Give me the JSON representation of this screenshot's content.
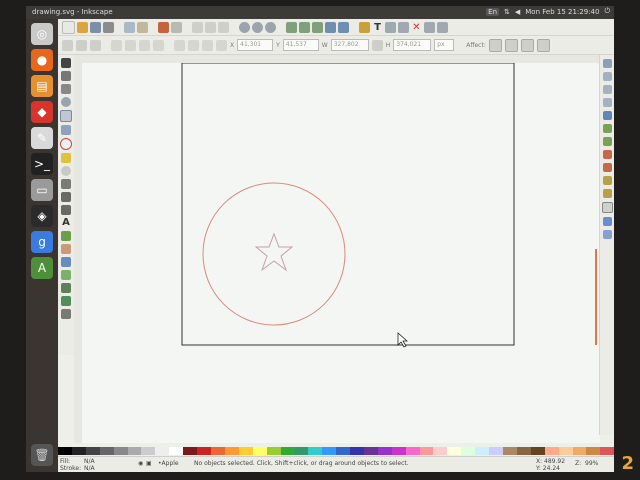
{
  "window": {
    "title": "drawing.svg - Inkscape"
  },
  "panel": {
    "clock": "Mon Feb 15 21:29:40",
    "power_glyph": "⏻",
    "indicator_glyph": "En"
  },
  "launcher": {
    "items": [
      {
        "name": "ubuntu-dash-icon",
        "glyph": "◎",
        "color": "#c9c9c9"
      },
      {
        "name": "firefox-icon",
        "glyph": "●",
        "color": "#e8671c"
      },
      {
        "name": "files-icon",
        "glyph": "▤",
        "color": "#e7902f"
      },
      {
        "name": "app-red-icon",
        "glyph": "◆",
        "color": "#d8332c"
      },
      {
        "name": "text-editor-icon",
        "glyph": "✎",
        "color": "#d9d9d9"
      },
      {
        "name": "terminal-icon",
        "glyph": ">_",
        "color": "#222"
      },
      {
        "name": "printer-icon",
        "glyph": "▭",
        "color": "#9a9a9a"
      },
      {
        "name": "inkscape-icon",
        "glyph": "◈",
        "color": "#2b2b2b"
      },
      {
        "name": "google-icon",
        "glyph": "g",
        "color": "#3b7be0"
      },
      {
        "name": "software-center-icon",
        "glyph": "A",
        "color": "#4e8f3a"
      }
    ],
    "trash_glyph": "🗑"
  },
  "controls": {
    "x_value": "41,301",
    "y_value": "41,537",
    "w_value": "327,802",
    "h_value": "374,021",
    "unit": "px",
    "affect_label": "Affect:"
  },
  "status": {
    "fill_label": "Fill:",
    "fill_value": "N/A",
    "stroke_label": "Stroke:",
    "stroke_value": "N/A",
    "layer": "•Apple",
    "message": "No objects selected. Click, Shift+click, or drag around objects to select.",
    "coord_x": "X: 489.92",
    "coord_y": "Y: 24.24",
    "zoom": "99%",
    "z_label": "Z:"
  },
  "bezel_number": "2",
  "colors": {
    "circle_stroke": "#d98a7a",
    "star_stroke": "#c8a0a0",
    "page_border": "#333333"
  }
}
